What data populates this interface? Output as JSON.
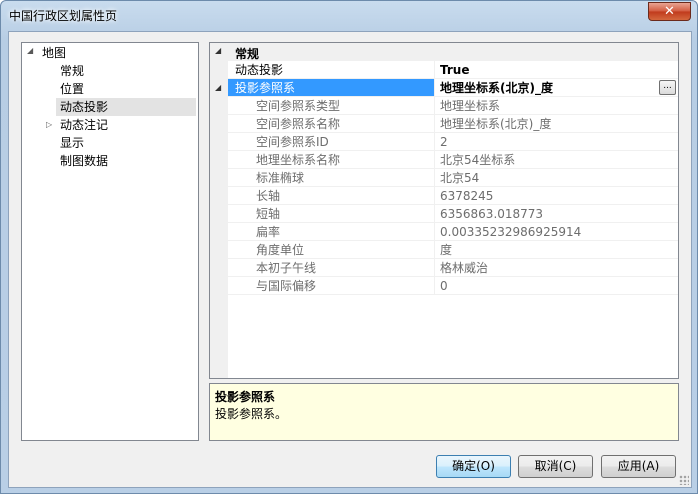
{
  "window": {
    "title": "中国行政区划属性页",
    "close_glyph": "✕"
  },
  "tree": {
    "root": "地图",
    "items": [
      {
        "label": "常规"
      },
      {
        "label": "位置"
      },
      {
        "label": "动态投影",
        "selected": true
      },
      {
        "label": "动态注记",
        "expandable": true
      },
      {
        "label": "显示"
      },
      {
        "label": "制图数据"
      }
    ]
  },
  "grid": {
    "category": "常规",
    "rows": [
      {
        "name": "动态投影",
        "value": "True"
      },
      {
        "name": "投影参照系",
        "value": "地理坐标系(北京)_度"
      }
    ],
    "ellipsis_label": "...",
    "subrows": [
      {
        "name": "空间参照系类型",
        "value": "地理坐标系"
      },
      {
        "name": "空间参照系名称",
        "value": "地理坐标系(北京)_度"
      },
      {
        "name": "空间参照系ID",
        "value": "2"
      },
      {
        "name": "地理坐标系名称",
        "value": "北京54坐标系"
      },
      {
        "name": "标准椭球",
        "value": "北京54"
      },
      {
        "name": "长轴",
        "value": "6378245"
      },
      {
        "name": "短轴",
        "value": "6356863.018773"
      },
      {
        "name": "扁率",
        "value": "0.00335232986925914"
      },
      {
        "name": "角度单位",
        "value": "度"
      },
      {
        "name": "本初子午线",
        "value": "格林威治"
      },
      {
        "name": "与国际偏移",
        "value": "0"
      }
    ]
  },
  "description": {
    "title": "投影参照系",
    "text": "投影参照系。"
  },
  "buttons": {
    "ok": "确定(O)",
    "cancel": "取消(C)",
    "apply": "应用(A)"
  }
}
